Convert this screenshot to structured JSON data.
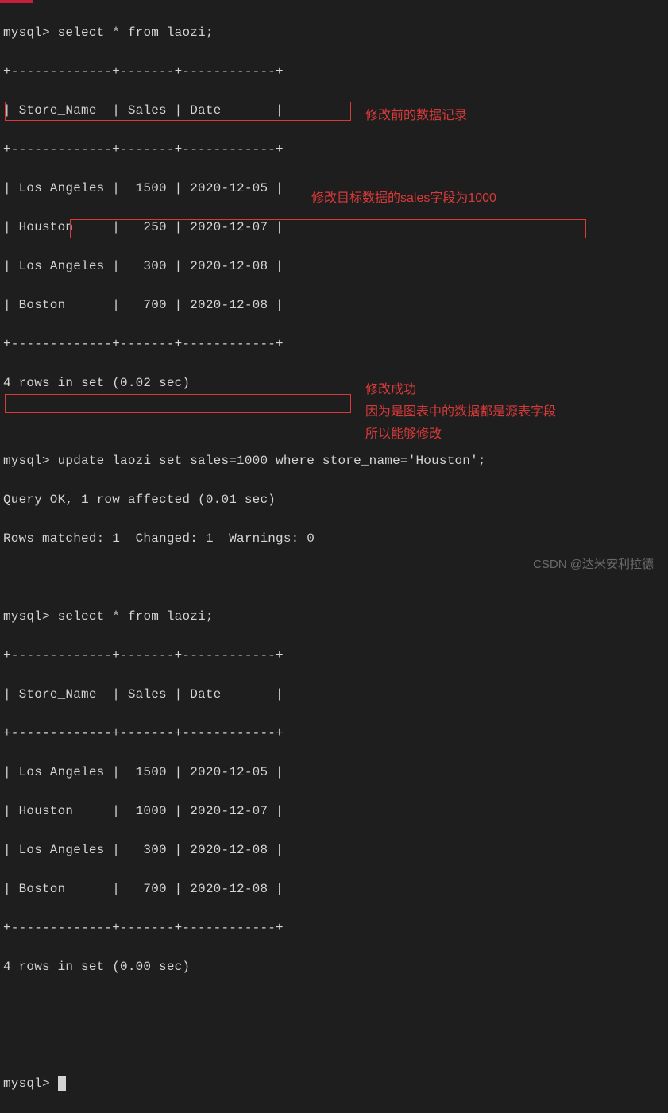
{
  "prompt": "mysql> ",
  "queries": {
    "select": "select * from laozi;",
    "update": "update laozi set sales=1000 where store_name='Houston';",
    "select2": "select * from laozi;"
  },
  "table": {
    "border_top": "+-------------+-------+------------+",
    "header": "| Store_Name  | Sales | Date       |",
    "border_mid": "+-------------+-------+------------+",
    "before_rows": [
      "| Los Angeles |  1500 | 2020-12-05 |",
      "| Houston     |   250 | 2020-12-07 |",
      "| Los Angeles |   300 | 2020-12-08 |",
      "| Boston      |   700 | 2020-12-08 |"
    ],
    "after_rows": [
      "| Los Angeles |  1500 | 2020-12-05 |",
      "| Houston     |  1000 | 2020-12-07 |",
      "| Los Angeles |   300 | 2020-12-08 |",
      "| Boston      |   700 | 2020-12-08 |"
    ],
    "border_bot": "+-------------+-------+------------+"
  },
  "results": {
    "rows_before": "4 rows in set (0.02 sec)",
    "update_ok": "Query OK, 1 row affected (0.01 sec)",
    "update_info": "Rows matched: 1  Changed: 1  Warnings: 0",
    "rows_after": "4 rows in set (0.00 sec)"
  },
  "annotations": {
    "a1": "修改前的数据记录",
    "a2": "修改目标数据的sales字段为1000",
    "a3": "修改成功",
    "a4": "因为是图表中的数据都是源表字段",
    "a5": "所以能够修改"
  },
  "watermark": "CSDN @达米安利拉德"
}
